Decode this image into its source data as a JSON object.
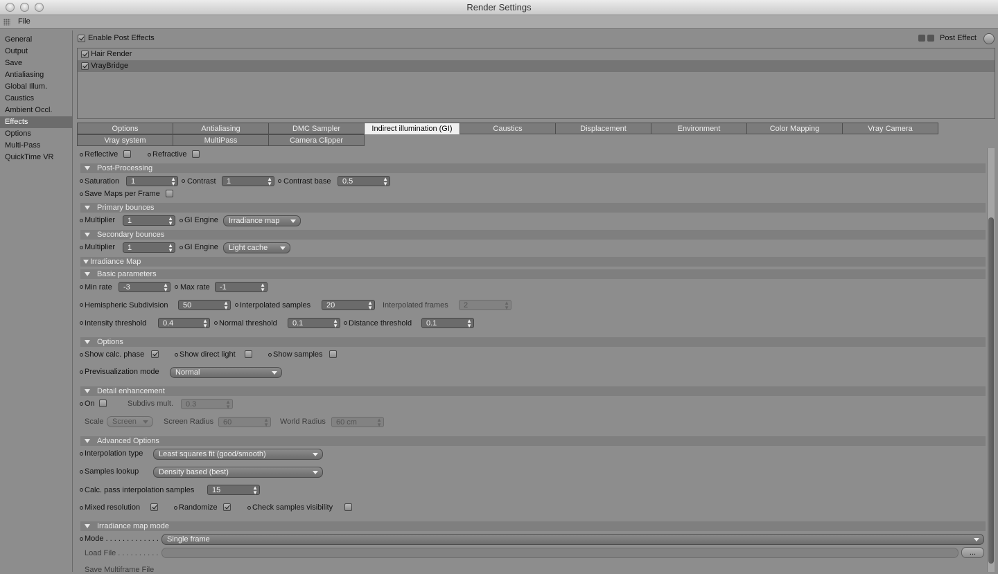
{
  "window": {
    "title": "Render Settings"
  },
  "menu": {
    "file": "File"
  },
  "sidebar": {
    "items": [
      {
        "label": "General"
      },
      {
        "label": "Output"
      },
      {
        "label": "Save"
      },
      {
        "label": "Antialiasing"
      },
      {
        "label": "Global Illum."
      },
      {
        "label": "Caustics"
      },
      {
        "label": "Ambient Occl."
      },
      {
        "label": "Effects",
        "active": true
      },
      {
        "label": "Options"
      },
      {
        "label": "Multi-Pass"
      },
      {
        "label": "QuickTime VR"
      }
    ]
  },
  "effects": {
    "enable_label": "Enable Post Effects",
    "post_effect_button": "Post Effect",
    "list": [
      {
        "label": "Hair Render",
        "checked": true
      },
      {
        "label": "VrayBridge",
        "checked": true,
        "selected": true
      }
    ]
  },
  "tabs": [
    {
      "label": "Options"
    },
    {
      "label": "Antialiasing"
    },
    {
      "label": "DMC Sampler"
    },
    {
      "label": "Indirect illumination (GI)",
      "active": true
    },
    {
      "label": "Caustics"
    },
    {
      "label": "Displacement"
    },
    {
      "label": "Environment"
    },
    {
      "label": "Color Mapping"
    },
    {
      "label": "Vray Camera"
    },
    {
      "label": "Vray system"
    },
    {
      "label": "MultiPass"
    },
    {
      "label": "Camera Clipper"
    }
  ],
  "gi": {
    "reflective": "Reflective",
    "refractive": "Refractive",
    "post_processing": "Post-Processing",
    "saturation": {
      "label": "Saturation",
      "value": "1"
    },
    "contrast": {
      "label": "Contrast",
      "value": "1"
    },
    "contrast_base": {
      "label": "Contrast base",
      "value": "0.5"
    },
    "save_maps": "Save Maps per Frame",
    "primary": "Primary bounces",
    "primary_multiplier": {
      "label": "Multiplier",
      "value": "1"
    },
    "primary_engine": {
      "label": "GI Engine",
      "value": "Irradiance map"
    },
    "secondary": "Secondary bounces",
    "secondary_multiplier": {
      "label": "Multiplier",
      "value": "1"
    },
    "secondary_engine": {
      "label": "GI Engine",
      "value": "Light cache"
    },
    "irradiance_map": "Irradiance Map",
    "basic": "Basic parameters",
    "min_rate": {
      "label": "Min rate",
      "value": "-3"
    },
    "max_rate": {
      "label": "Max rate",
      "value": "-1"
    },
    "hemi": {
      "label": "Hemispheric Subdivision",
      "value": "50"
    },
    "interp_samples": {
      "label": "Interpolated samples",
      "value": "20"
    },
    "interp_frames": {
      "label": "Interpolated frames",
      "value": "2"
    },
    "intensity": {
      "label": "Intensity threshold",
      "value": "0.4"
    },
    "normal": {
      "label": "Normal threshold",
      "value": "0.1"
    },
    "distance": {
      "label": "Distance threshold",
      "value": "0.1"
    },
    "options": "Options",
    "show_calc": "Show calc. phase",
    "show_direct": "Show direct light",
    "show_samples": "Show samples",
    "previs": {
      "label": "Previsualization mode",
      "value": "Normal"
    },
    "detail": "Detail enhancement",
    "on": "On",
    "subdivs": {
      "label": "Subdivs mult.",
      "value": "0.3"
    },
    "scale": {
      "label": "Scale",
      "value": "Screen"
    },
    "screen_radius": {
      "label": "Screen Radius",
      "value": "60"
    },
    "world_radius": {
      "label": "World Radius",
      "value": "60 cm"
    },
    "advanced": "Advanced Options",
    "interp_type": {
      "label": "Interpolation type",
      "value": "Least squares fit (good/smooth)"
    },
    "lookup": {
      "label": "Samples lookup",
      "value": "Density based (best)"
    },
    "calc_pass": {
      "label": "Calc. pass interpolation samples",
      "value": "15"
    },
    "mixed": "Mixed resolution",
    "randomize": "Randomize",
    "check_vis": "Check samples visibility",
    "irr_mode": "Irradiance map mode",
    "mode": {
      "label": "Mode . . . . . . . . . . . . . .",
      "value": "Single frame"
    },
    "load_file": {
      "label": "Load File . . . . . . . . . .",
      "browse": "..."
    },
    "save_multi": "Save Multiframe File"
  }
}
